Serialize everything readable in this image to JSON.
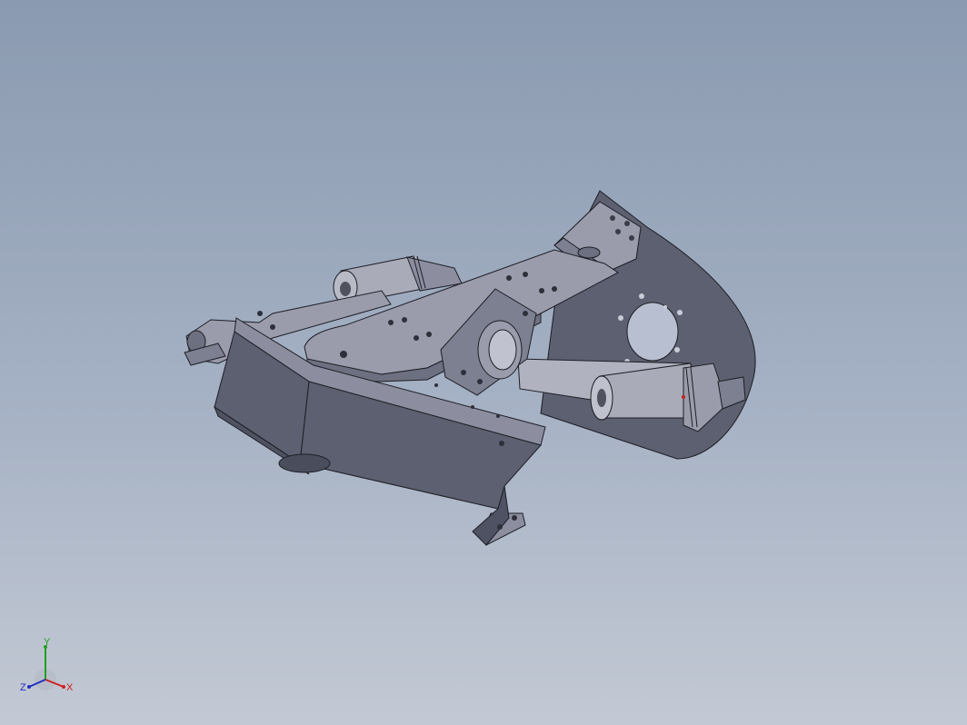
{
  "viewport": {
    "background_top": "#8a9ab0",
    "background_bottom": "#c3c9d4"
  },
  "model": {
    "body_color": "#5d6070",
    "face_light": "#9a9cab",
    "face_mid": "#7d8091",
    "face_dark": "#4f5262",
    "cylinder_color": "#a9abb8",
    "edge_color": "#1d1e25"
  },
  "triad": {
    "x_label": "X",
    "y_label": "Y",
    "z_label": "Z",
    "x_color": "#d02020",
    "y_color": "#20a020",
    "z_color": "#2030c0"
  }
}
